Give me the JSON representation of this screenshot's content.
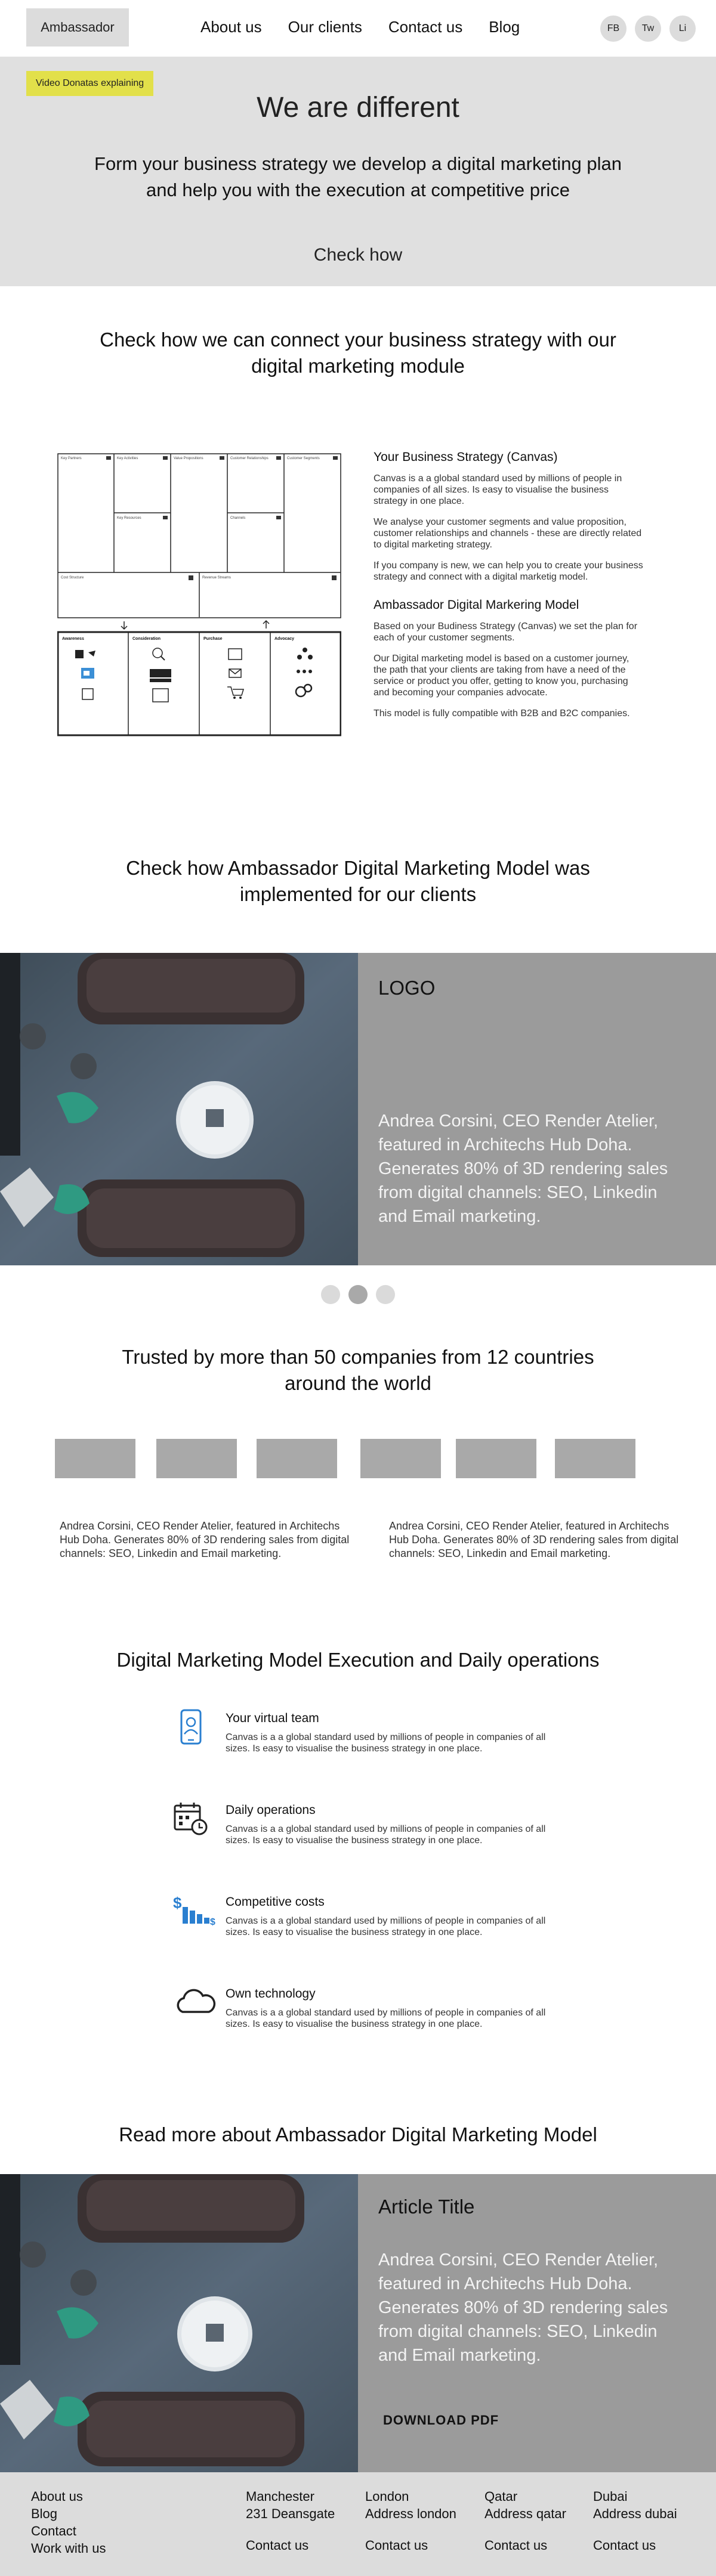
{
  "header": {
    "logo": "Ambassador",
    "nav": [
      "About us",
      "Our clients",
      "Contact us",
      "Blog"
    ],
    "social": [
      "FB",
      "Tw",
      "Li"
    ]
  },
  "hero": {
    "badge": "Video Donatas explaining",
    "title": "We are different",
    "subtitle": "Form your business strategy we develop a digital marketing plan and help you with the execution at competitive price",
    "cta": "Check how"
  },
  "connect": {
    "title": "Check how we can connect your business strategy with our digital marketing module",
    "canvas_heading": "Your Business Strategy (Canvas)",
    "canvas_paragraphs": [
      "Canvas is a a global standard used by millions of people in companies of all sizes. Is easy to visualise the business strategy in one place.",
      "We analyse your customer segments and value proposition, customer relationships and channels - these are directly related to digital marketing strategy.",
      "If you company is new, we can help you to create your business strategy and connect with a digital marketig model."
    ],
    "model_heading": "Ambassador Digital Markering Model",
    "model_paragraphs": [
      "Based on your Budiness Strategy (Canvas) we set the plan for each of your customer segments.",
      "Our Digital marketing model is based on a customer journey, the path that your clients are taking from have a need of the service or product you offer, getting to know you, purchasing and becoming your companies advocate.",
      "This model is fully compatible with B2B and B2C companies."
    ],
    "diagram": {
      "canvas_cells": [
        "Key Partners",
        "Key Activities",
        "Value Propositions",
        "Customer Relationships",
        "Customer Segments",
        "Key Resources",
        "Channels",
        "Cost Structure",
        "Revenue Streams"
      ],
      "stages": [
        "Awareness",
        "Consideration",
        "Purchase",
        "Advocacy"
      ]
    }
  },
  "implemented": {
    "title": "Check how Ambassador Digital Marketing Model was implemented for our clients",
    "logo": "LOGO",
    "quote": "Andrea Corsini, CEO Render Atelier, featured in Architechs Hub Doha. Generates 80% of 3D rendering sales from digital channels: SEO, Linkedin and Email marketing.",
    "dots": 3,
    "active_dot": 2
  },
  "trusted": {
    "title": "Trusted by more than 50 companies from 12 countries around the world",
    "logo_count": 6,
    "testimonials": [
      "Andrea Corsini, CEO Render Atelier, featured in Architechs Hub Doha. Generates 80% of 3D rendering sales from digital channels: SEO, Linkedin and Email marketing.",
      "Andrea Corsini, CEO Render Atelier, featured in Architechs Hub Doha. Generates 80% of 3D rendering sales from digital channels: SEO, Linkedin and Email marketing."
    ]
  },
  "execution": {
    "title": "Digital Marketing Model Execution and Daily operations",
    "features": [
      {
        "title": "Your virtual team",
        "text": "Canvas is a a global standard used by millions of people in companies of all sizes. Is easy to visualise the business strategy in one place.",
        "icon": "phone-icon"
      },
      {
        "title": "Daily operations",
        "text": "Canvas is a a global standard used by millions of people in companies of all sizes. Is easy to visualise the business strategy in one place.",
        "icon": "calendar-icon"
      },
      {
        "title": "Competitive costs",
        "text": "Canvas is a a global standard used by millions of people in companies of all sizes. Is easy to visualise the business strategy in one place.",
        "icon": "cost-chart-icon"
      },
      {
        "title": "Own technology",
        "text": "Canvas is a a global standard used by millions of people in companies of all sizes. Is easy to visualise the business strategy in one place.",
        "icon": "cloud-icon"
      }
    ]
  },
  "article": {
    "section_title": "Read more about Ambassador Digital Marketing Model",
    "title": "Article Title",
    "text": "Andrea Corsini, CEO Render Atelier, featured in Architechs Hub Doha. Generates 80% of 3D rendering sales from digital channels: SEO, Linkedin and Email marketing.",
    "download": "DOWNLOAD PDF"
  },
  "footer": {
    "links": [
      "About us",
      "Blog",
      "Contact",
      "Work with us"
    ],
    "offices": [
      {
        "city": "Manchester",
        "address": "231 Deansgate",
        "contact": "Contact us"
      },
      {
        "city": "London",
        "address": "Address london",
        "contact": "Contact us"
      },
      {
        "city": "Qatar",
        "address": "Address qatar",
        "contact": "Contact us"
      },
      {
        "city": "Dubai",
        "address": "Address dubai",
        "contact": "Contact us"
      }
    ]
  },
  "colors": {
    "hero_bg": "#e0e0e0",
    "badge": "#e2e04a",
    "panel_gray": "#9b9b9b",
    "icon_blue": "#2a7fd0"
  }
}
